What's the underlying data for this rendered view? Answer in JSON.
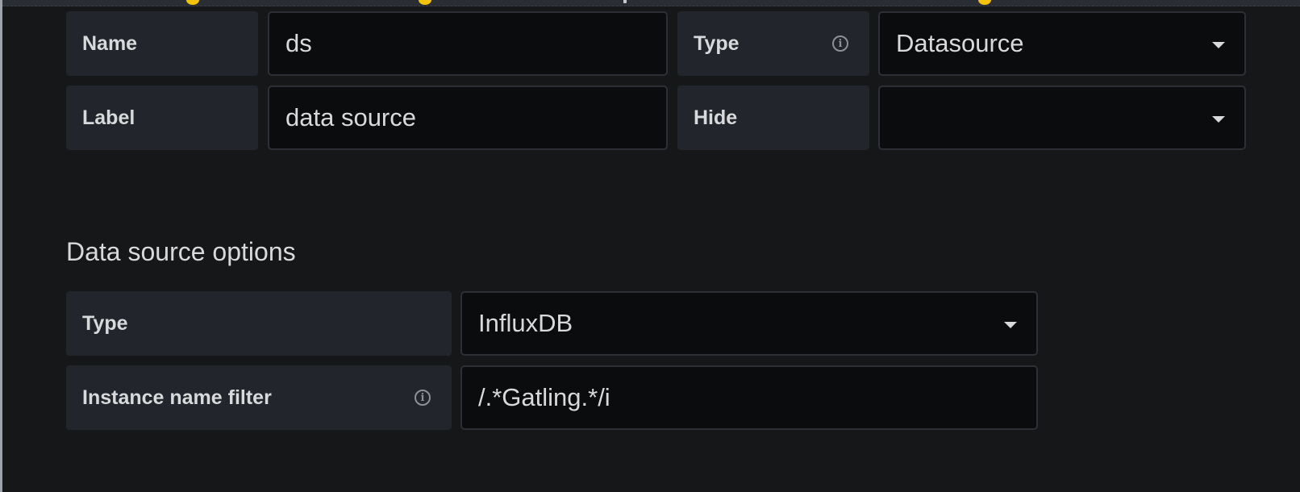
{
  "variable_editor": {
    "general": {
      "name": {
        "label": "Name",
        "value": "ds"
      },
      "type": {
        "label": "Type",
        "info_icon": "info-circle-icon",
        "selected": "Datasource"
      },
      "label": {
        "label": "Label",
        "value": "data source"
      },
      "hide": {
        "label": "Hide",
        "selected": ""
      }
    },
    "datasource_options": {
      "title": "Data source options",
      "type": {
        "label": "Type",
        "selected": "InfluxDB"
      },
      "instance_name_filter": {
        "label": "Instance name filter",
        "info_icon": "info-circle-icon",
        "value": "/.*Gatling.*/i"
      }
    }
  },
  "colors": {
    "background": "#161719",
    "label_bg": "#22252b",
    "input_bg": "#0b0c0e",
    "input_border": "#2c2f35",
    "text": "#d8d9da",
    "marker": "#f2c30a"
  }
}
